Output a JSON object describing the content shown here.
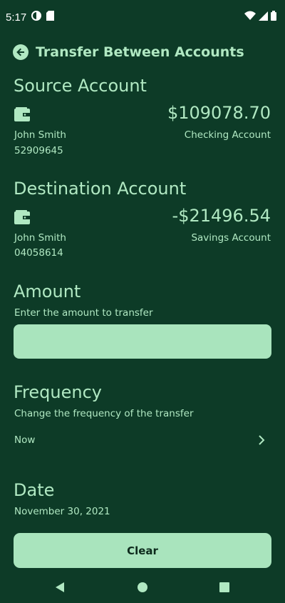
{
  "status_bar": {
    "time": "5:17",
    "icons": [
      "data-saver-icon",
      "sim-card-icon",
      "wifi-icon",
      "signal-icon",
      "battery-icon"
    ]
  },
  "header": {
    "title": "Transfer Between Accounts",
    "back_icon": "arrow-back-icon"
  },
  "source": {
    "heading": "Source Account",
    "icon": "wallet-icon",
    "balance": "$109078.70",
    "owner": "John Smith",
    "number": "52909645",
    "type": "Checking Account"
  },
  "destination": {
    "heading": "Destination Account",
    "icon": "wallet-icon",
    "balance": "-$21496.54",
    "owner": "John Smith",
    "number": "04058614",
    "type": "Savings Account"
  },
  "amount": {
    "heading": "Amount",
    "hint": "Enter the amount to transfer",
    "value": ""
  },
  "frequency": {
    "heading": "Frequency",
    "hint": "Change the frequency of the transfer",
    "value": "Now"
  },
  "date": {
    "heading": "Date",
    "value": "November 30, 2021"
  },
  "actions": {
    "clear_label": "Clear"
  },
  "colors": {
    "background": "#0d3b27",
    "accent": "#b0e8c2",
    "field": "#a9e4bd"
  }
}
